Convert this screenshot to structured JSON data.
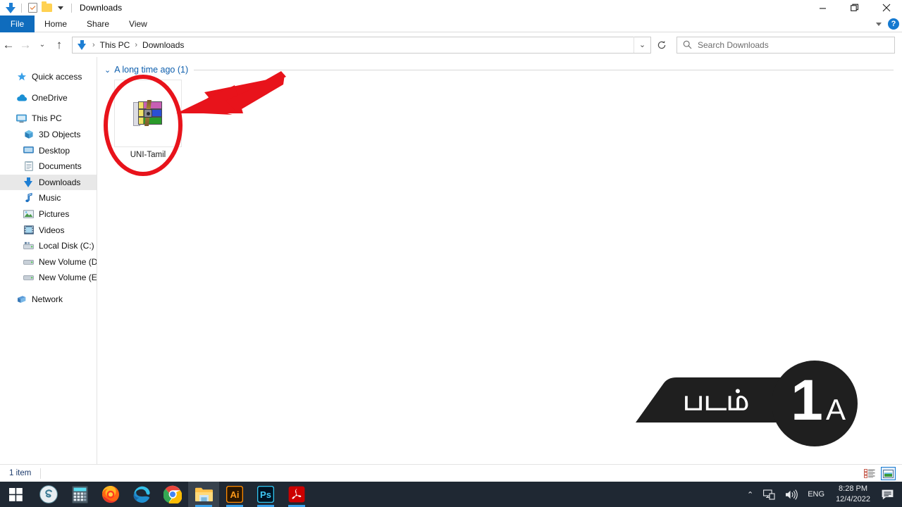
{
  "window": {
    "title": "Downloads",
    "quick_access": [
      "download-arrow-icon",
      "properties-icon",
      "new-folder-icon",
      "customize-caret-icon"
    ],
    "controls": {
      "minimize": "Minimize",
      "restore": "Restore",
      "close": "Close"
    }
  },
  "ribbon": {
    "tabs": [
      {
        "label": "File",
        "active": true
      },
      {
        "label": "Home",
        "active": false
      },
      {
        "label": "Share",
        "active": false
      },
      {
        "label": "View",
        "active": false
      }
    ],
    "collapse_label": "Minimize the Ribbon",
    "help_label": "?"
  },
  "address": {
    "back": "Back",
    "forward": "Forward",
    "recent": "Recent locations",
    "up": "Up",
    "breadcrumbs": [
      "This PC",
      "Downloads"
    ],
    "separator": "›",
    "dropdown": "Previous locations",
    "refresh": "Refresh"
  },
  "search": {
    "placeholder": "Search Downloads",
    "icon": "search-icon",
    "value": ""
  },
  "sidebar": {
    "items": [
      {
        "label": "Quick access",
        "icon": "star-icon",
        "level": 1,
        "selected": false
      },
      {
        "label": "OneDrive",
        "icon": "cloud-icon",
        "level": 1,
        "selected": false
      },
      {
        "label": "This PC",
        "icon": "monitor-icon",
        "level": 1,
        "selected": false
      },
      {
        "label": "3D Objects",
        "icon": "cube-icon",
        "level": 2,
        "selected": false
      },
      {
        "label": "Desktop",
        "icon": "desktop-icon",
        "level": 2,
        "selected": false
      },
      {
        "label": "Documents",
        "icon": "document-icon",
        "level": 2,
        "selected": false
      },
      {
        "label": "Downloads",
        "icon": "download-arrow-icon",
        "level": 2,
        "selected": true
      },
      {
        "label": "Music",
        "icon": "music-note-icon",
        "level": 2,
        "selected": false
      },
      {
        "label": "Pictures",
        "icon": "picture-icon",
        "level": 2,
        "selected": false
      },
      {
        "label": "Videos",
        "icon": "video-icon",
        "level": 2,
        "selected": false
      },
      {
        "label": "Local Disk (C:)",
        "icon": "local-disk-icon",
        "level": 2,
        "selected": false
      },
      {
        "label": "New Volume (D:)",
        "icon": "drive-icon",
        "level": 2,
        "selected": false
      },
      {
        "label": "New Volume (E:)",
        "icon": "drive-icon",
        "level": 2,
        "selected": false
      },
      {
        "label": "Network",
        "icon": "network-icon",
        "level": 1,
        "selected": false
      }
    ]
  },
  "content": {
    "group_header": "A long time ago (1)",
    "group_chevron": "⌄",
    "files": [
      {
        "name": "UNI-Tamil",
        "icon": "winrar-archive-icon"
      }
    ]
  },
  "annotations": {
    "circle": {
      "color": "#e8131b",
      "shape": "ellipse-highlight"
    },
    "arrow": {
      "color": "#e8131b",
      "shape": "pointer-arrow"
    }
  },
  "badge": {
    "text": "படம்",
    "number": "1",
    "suffix": "A",
    "bg_color": "#1f1f1f",
    "fg_color": "#ffffff"
  },
  "statusbar": {
    "item_count": "1 item",
    "views": [
      {
        "name": "details-view",
        "active": false
      },
      {
        "name": "large-icons-view",
        "active": true
      }
    ]
  },
  "taskbar": {
    "start": "Start",
    "apps": [
      {
        "name": "skype-icon",
        "label": "Skype"
      },
      {
        "name": "calculator-icon",
        "label": "Calculator"
      },
      {
        "name": "firefox-icon",
        "label": "Firefox"
      },
      {
        "name": "edge-icon",
        "label": "Microsoft Edge"
      },
      {
        "name": "chrome-icon",
        "label": "Google Chrome"
      },
      {
        "name": "file-explorer-icon",
        "label": "File Explorer"
      },
      {
        "name": "illustrator-icon",
        "label": "Ai"
      },
      {
        "name": "photoshop-icon",
        "label": "Ps"
      },
      {
        "name": "acrobat-icon",
        "label": "Adobe Acrobat"
      }
    ],
    "tray": {
      "overflow": "⌃",
      "network": "network-icon",
      "volume": "volume-icon",
      "language": "ENG",
      "time": "8:28 PM",
      "date": "12/4/2022",
      "action_center": "notifications-icon"
    }
  }
}
